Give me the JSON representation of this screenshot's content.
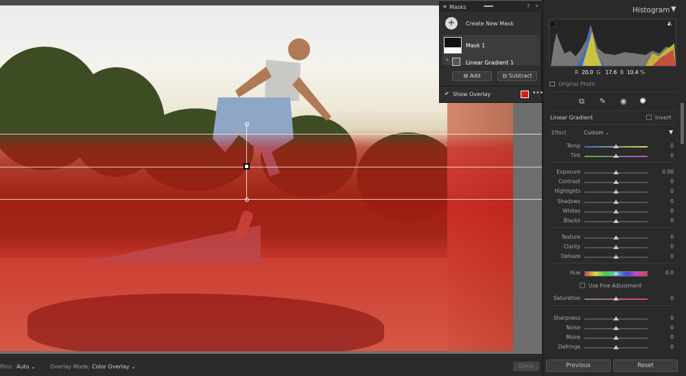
{
  "masks_panel": {
    "title": "Masks",
    "create_new_mask": "Create New Mask",
    "mask_name": "Mask 1",
    "component_name": "Linear Gradient 1",
    "add_label": "Add",
    "subtract_label": "Subtract",
    "show_overlay_label": "Show Overlay",
    "overlay_color": "#e01818",
    "more_icon": "more-icon"
  },
  "toolbar": {
    "pins_label": "Pins:",
    "pins_value": "Auto",
    "overlay_mode_label": "Overlay Mode:",
    "overlay_mode_value": "Color Overlay",
    "done_label": "Done"
  },
  "histogram": {
    "title": "Histogram",
    "r_label": "R",
    "r_value": "20.0",
    "g_label": "G",
    "g_value": "17.6",
    "b_label": "B",
    "b_value": "10.4",
    "percent": "%",
    "original_photo": "Original Photo"
  },
  "tools": [
    "crop-icon",
    "heal-icon",
    "redeye-icon",
    "mask-icon"
  ],
  "gradient_panel": {
    "title": "Linear Gradient",
    "invert_label": "Invert",
    "effect_label": "Effect",
    "effect_value": "Custom"
  },
  "sliders_white_balance": [
    {
      "label": "Temp",
      "value": "0",
      "level": 0.5
    },
    {
      "label": "Tint",
      "value": "0",
      "level": 0.5
    }
  ],
  "sliders_tone": [
    {
      "label": "Exposure",
      "value": "0.00",
      "level": 0.5
    },
    {
      "label": "Contrast",
      "value": "0",
      "level": 0.5
    },
    {
      "label": "Highlights",
      "value": "0",
      "level": 0.5
    },
    {
      "label": "Shadows",
      "value": "0",
      "level": 0.5
    },
    {
      "label": "Whites",
      "value": "0",
      "level": 0.5
    },
    {
      "label": "Blacks",
      "value": "0",
      "level": 0.5
    }
  ],
  "sliders_presence": [
    {
      "label": "Texture",
      "value": "0",
      "level": 0.5
    },
    {
      "label": "Clarity",
      "value": "0",
      "level": 0.5
    },
    {
      "label": "Dehaze",
      "value": "0",
      "level": 0.5
    }
  ],
  "hue": {
    "label": "Hue",
    "value": "0.0",
    "level": 0.5,
    "fine_label": "Use Fine Adjustment"
  },
  "saturation": {
    "label": "Saturation",
    "value": "0",
    "level": 0.5
  },
  "sliders_detail": [
    {
      "label": "Sharpness",
      "value": "0",
      "level": 0.5
    },
    {
      "label": "Noise",
      "value": "0",
      "level": 0.5
    },
    {
      "label": "Moire",
      "value": "0",
      "level": 0.5
    },
    {
      "label": "Defringe",
      "value": "0",
      "level": 0.5
    }
  ],
  "buttons": {
    "previous": "Previous",
    "reset": "Reset"
  },
  "colors": {
    "accent": "#e01818",
    "panel": "#2a2a2a"
  }
}
